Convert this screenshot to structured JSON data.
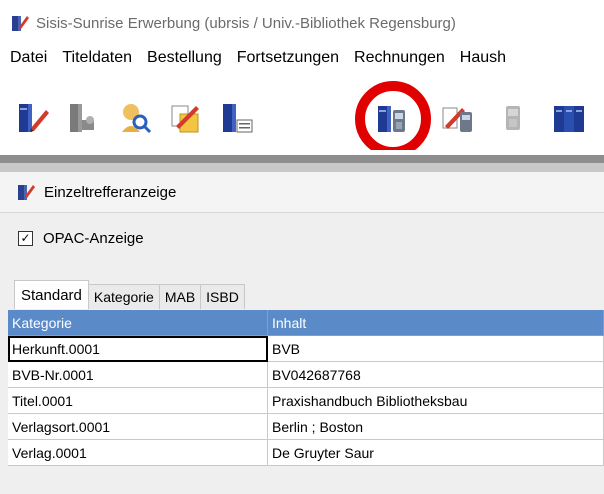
{
  "annotation": {
    "quote_mark": "„"
  },
  "window": {
    "title": "Sisis-Sunrise Erwerbung (ubrsis / Univ.-Bibliothek Regensburg)"
  },
  "menu": [
    "Datei",
    "Titeldaten",
    "Bestellung",
    "Fortsetzungen",
    "Rechnungen",
    "Haush"
  ],
  "toolbar": {
    "icons": [
      "edit-book-icon",
      "book-search-icon",
      "person-search-icon",
      "copy-edit-icon",
      "book-list-icon",
      "book-phone-icon",
      "phone-edit-icon",
      "disabled-phone-icon",
      "books-icon"
    ],
    "highlighted": "book-phone-icon",
    "highlight_color": "#e00000"
  },
  "panel": {
    "title": "Einzeltrefferanzeige"
  },
  "opac": {
    "label": "OPAC-Anzeige",
    "checked": true
  },
  "tabs": [
    "Standard",
    "Kategorie",
    "MAB",
    "ISBD"
  ],
  "table": {
    "headers": [
      "Kategorie",
      "Inhalt"
    ],
    "rows": [
      [
        "Herkunft.0001",
        "BVB"
      ],
      [
        "BVB-Nr.0001",
        "BV042687768"
      ],
      [
        "Titel.0001",
        "Praxishandbuch Bibliotheksbau"
      ],
      [
        "Verlagsort.0001",
        "Berlin ; Boston"
      ],
      [
        "Verlag.0001",
        "De Gruyter Saur"
      ]
    ],
    "header_color": "#5b8ac8"
  }
}
